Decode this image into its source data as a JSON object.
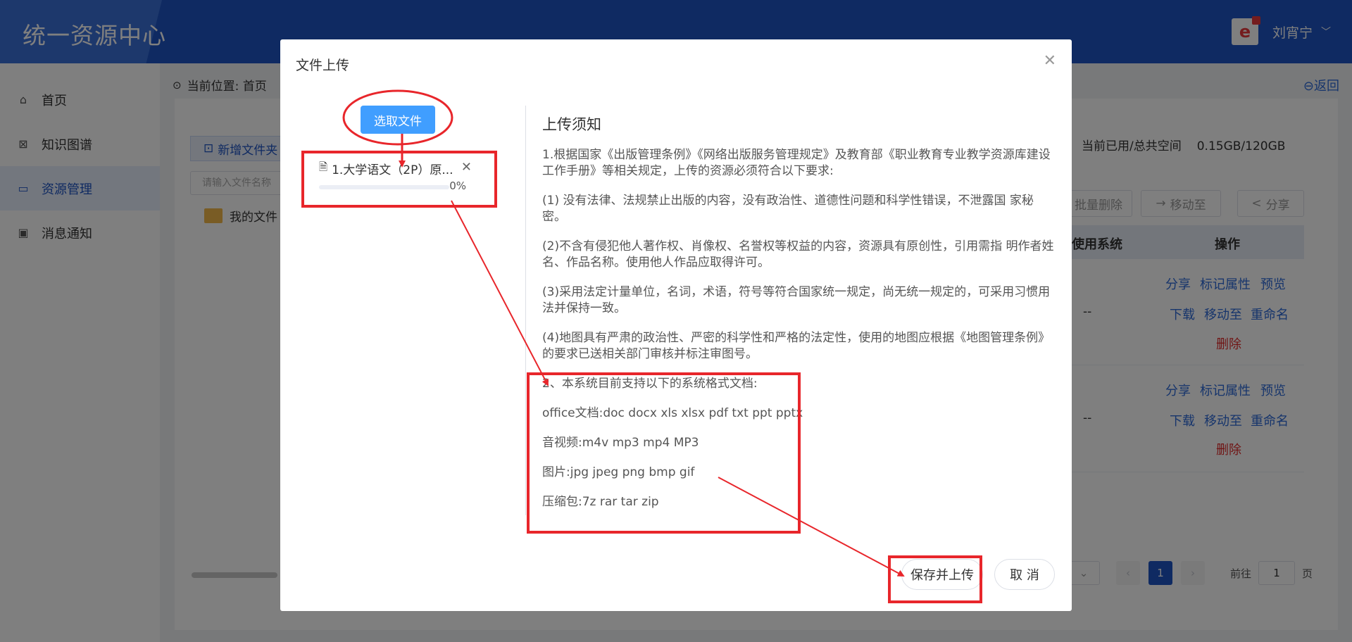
{
  "header": {
    "brand": "统一资源中心",
    "user_name": "刘宵宁",
    "avatar_letter": "e"
  },
  "sidebar": {
    "items": [
      {
        "label": "首页",
        "icon": "home-icon"
      },
      {
        "label": "知识图谱",
        "icon": "graph-icon"
      },
      {
        "label": "资源管理",
        "icon": "folder-manage-icon",
        "active": true
      },
      {
        "label": "消息通知",
        "icon": "message-icon"
      }
    ]
  },
  "breadcrumb": {
    "text": "当前位置: 首页",
    "back": "返回"
  },
  "main": {
    "new_folder": "新增文件夹",
    "search_placeholder": "请输入文件名称",
    "folder_name": "我的文件",
    "space_label": "当前已用/总共空间",
    "space_value": "0.15GB/120GB",
    "toolbar": {
      "batch_delete": "批量删除",
      "move_to": "移动至",
      "share": "分享"
    },
    "table_headers": {
      "system": "使用系统",
      "ops": "操作"
    },
    "row_actions": {
      "share": "分享",
      "mark": "标记属性",
      "preview": "预览",
      "download": "下载",
      "move": "移动至",
      "rename": "重命名",
      "delete": "删除"
    },
    "row_dash": "--",
    "pager": {
      "current_page": "1",
      "goto_prefix": "前往",
      "goto_value": "1",
      "goto_suffix": "页"
    }
  },
  "dialog": {
    "title": "文件上传",
    "pick_button": "选取文件",
    "file_name": "1.大学语文（2P）原...",
    "progress_percent": 0,
    "progress_text": "0%",
    "notice_title": "上传须知",
    "notice_paragraphs": [
      "1.根据国家《出版管理条例》《网络出版服务管理规定》及教育部《职业教育专业教学资源库建设工作手册》等相关规定，上传的资源必须符合以下要求:",
      "(1) 没有法律、法规禁止出版的内容，没有政治性、道德性问题和科学性错误，不泄露国 家秘密。",
      "(2)不含有侵犯他人著作权、肖像权、名誉权等权益的内容，资源具有原创性，引用需指 明作者姓名、作品名称。使用他人作品应取得许可。",
      "(3)采用法定计量单位，名词，术语，符号等符合国家统一规定，尚无统一规定的，可采用习惯用法并保持一致。",
      "(4)地图具有严肃的政治性、严密的科学性和严格的法定性，使用的地图应根据《地图管理条例》的要求已送相关部门审核并标注审图号。"
    ],
    "formats": [
      "2、本系统目前支持以下的系统格式文档:",
      "office文档:doc docx xls xlsx pdf txt ppt pptx",
      "音视频:m4v mp3 mp4 MP3",
      "图片:jpg jpeg png bmp gif",
      "压缩包:7z rar tar zip"
    ],
    "save_button": "保存并上传",
    "cancel_button": "取 消"
  }
}
